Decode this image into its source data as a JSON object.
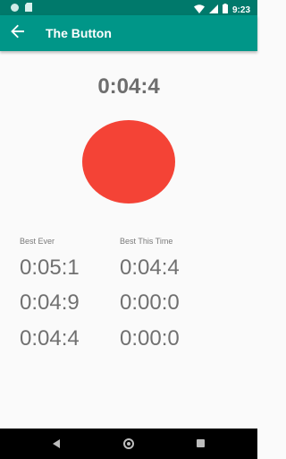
{
  "status_bar": {
    "time": "9:23"
  },
  "app_bar": {
    "title": "The Button"
  },
  "timer": {
    "value": "0:04:4"
  },
  "scores": {
    "best_ever": {
      "label": "Best Ever",
      "values": [
        "0:05:1",
        "0:04:9",
        "0:04:4"
      ]
    },
    "best_this_time": {
      "label": "Best This Time",
      "values": [
        "0:04:4",
        "0:00:0",
        "0:00:0"
      ]
    }
  },
  "colors": {
    "status_bar": "#00796b",
    "app_bar": "#009688",
    "button": "#f44336",
    "text_gray": "#6e6e6e"
  },
  "icons": [
    "back-arrow-icon",
    "wifi-icon",
    "signal-icon",
    "battery-icon",
    "nav-back-icon",
    "nav-home-icon",
    "nav-recents-icon"
  ]
}
